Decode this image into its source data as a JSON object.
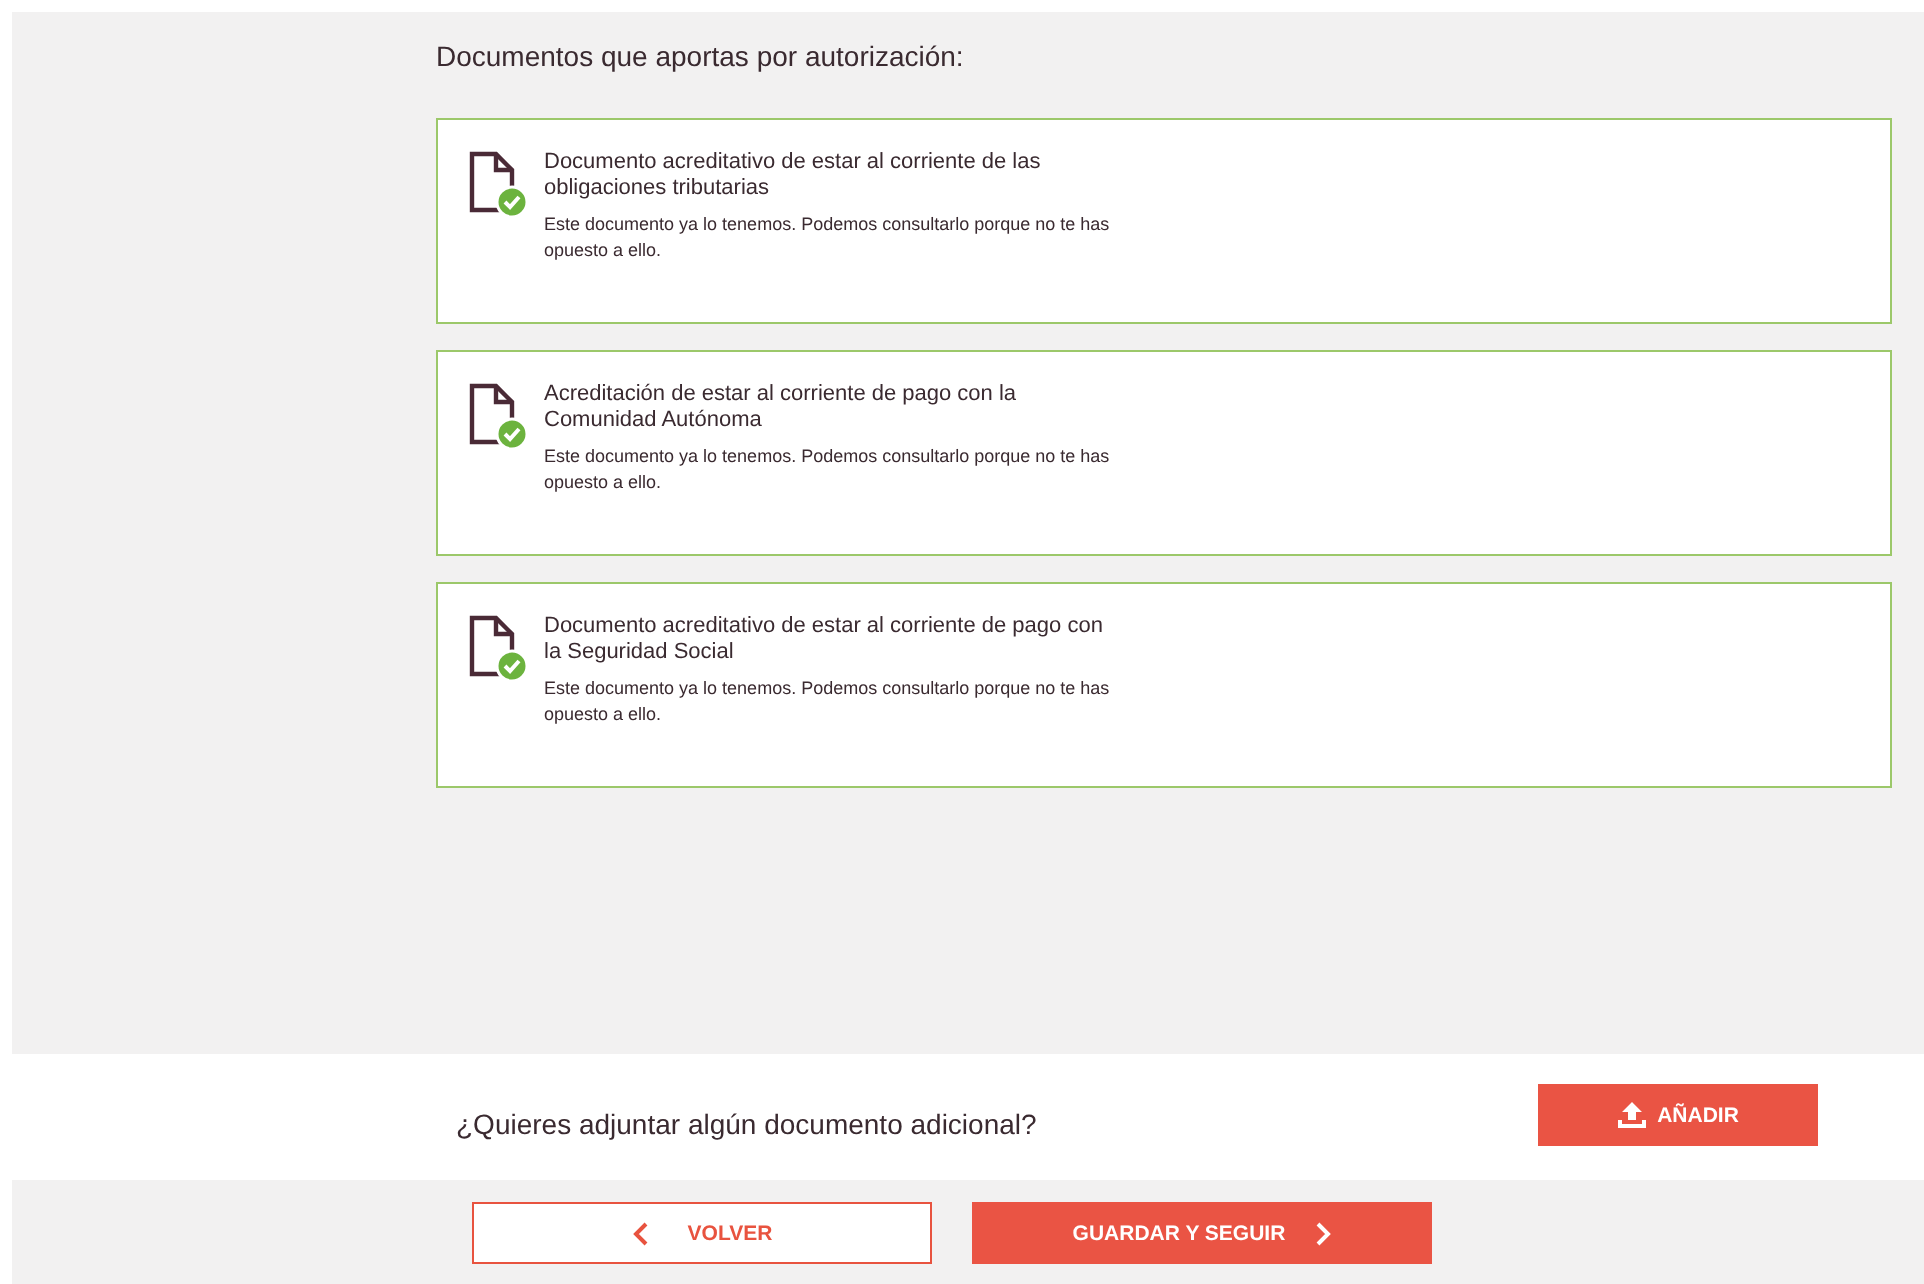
{
  "section_title": "Documentos que aportas por autorización:",
  "documents": [
    {
      "title": "Documento acreditativo de estar al corriente de las obligaciones tributarias",
      "note": "Este documento ya lo tenemos. Podemos consultarlo porque no te has opuesto a ello.",
      "verified": true
    },
    {
      "title": "Acreditación de estar al corriente de pago con la Comunidad Autónoma",
      "note": "Este documento ya lo tenemos. Podemos consultarlo porque no te has opuesto a ello.",
      "verified": true
    },
    {
      "title": "Documento acreditativo de estar al corriente de pago con la Seguridad Social",
      "note": "Este documento ya lo tenemos. Podemos consultarlo porque no te has opuesto a ello.",
      "verified": true
    }
  ],
  "additional": {
    "question": "¿Quieres adjuntar algún documento adicional?",
    "button": "AÑADIR"
  },
  "footer": {
    "back": "VOLVER",
    "next": "GUARDAR Y SEGUIR"
  }
}
